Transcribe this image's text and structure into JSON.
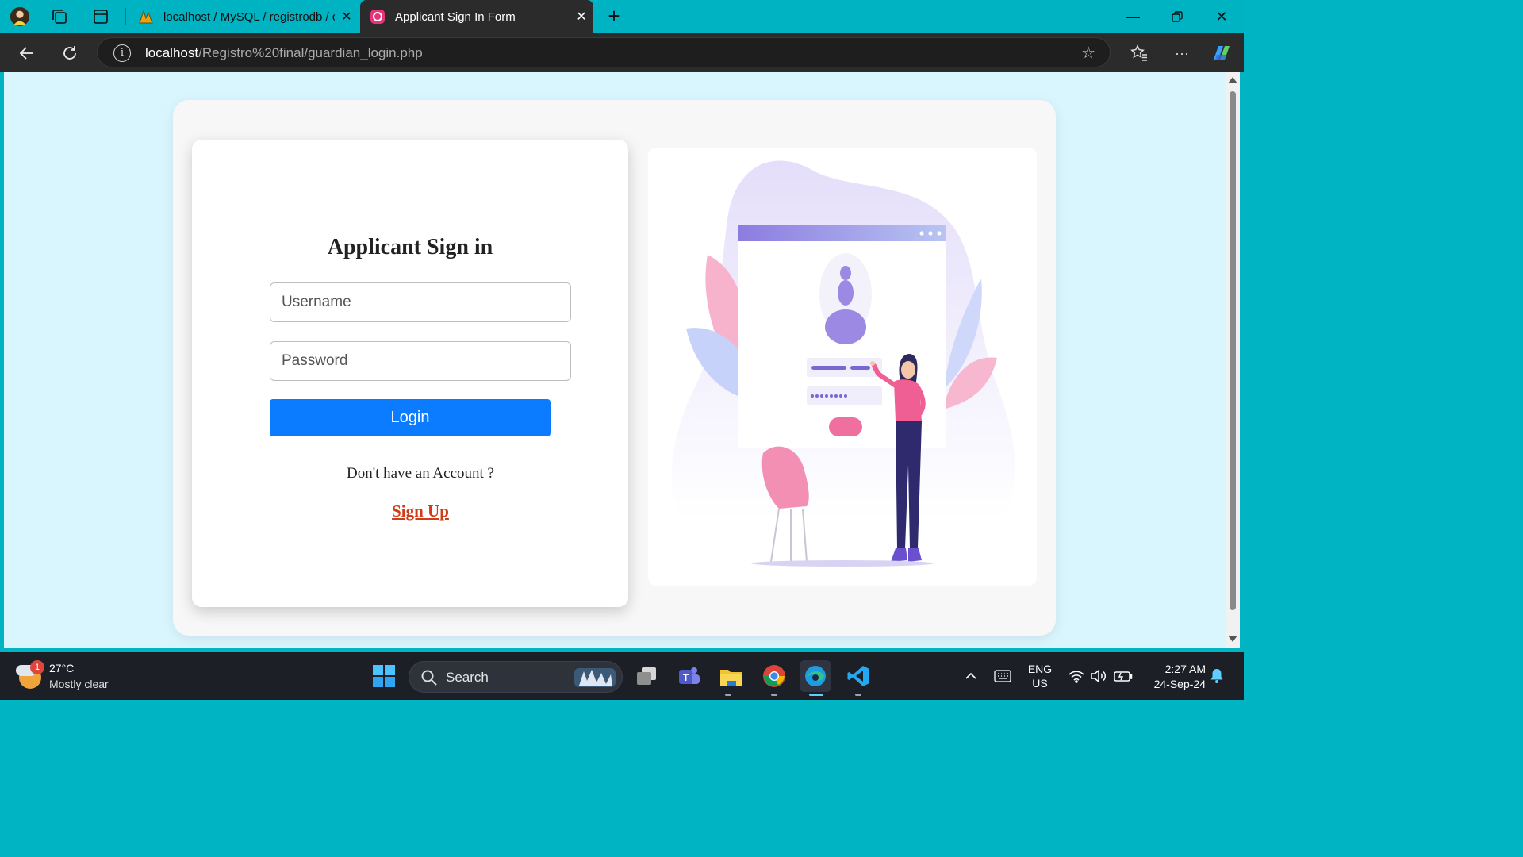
{
  "browser": {
    "tabs": [
      {
        "title": "localhost / MySQL / registrodb / c",
        "active": false
      },
      {
        "title": "Applicant Sign In Form",
        "active": true
      }
    ],
    "url_host": "localhost",
    "url_path": "/Registro%20final/guardian_login.php"
  },
  "form": {
    "title": "Applicant Sign in",
    "username_placeholder": "Username",
    "password_placeholder": "Password",
    "login_label": "Login",
    "no_account_text": "Don't have an Account ?",
    "signup_label": "Sign Up"
  },
  "colors": {
    "page_bg": "#d9f5fd",
    "login_button": "#0b7cff",
    "signup_link": "#d23b16",
    "tab_strip": "#00b3c2"
  },
  "taskbar": {
    "weather_badge": "1",
    "temperature": "27°C",
    "condition": "Mostly clear",
    "search_label": "Search",
    "lang_line1": "ENG",
    "lang_line2": "US",
    "time": "2:27 AM",
    "date": "24-Sep-24"
  }
}
